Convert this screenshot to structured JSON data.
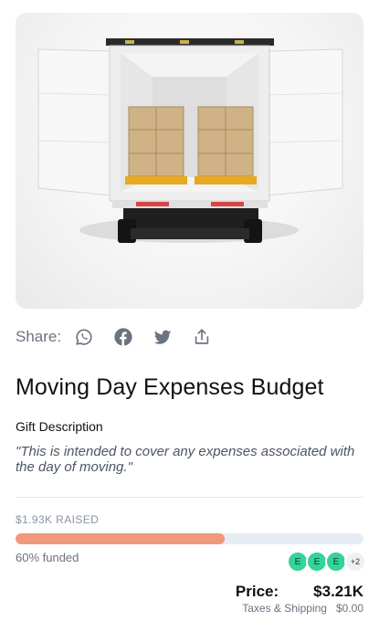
{
  "hero": {
    "image_alt": "Open moving truck with boxes on pallets"
  },
  "share": {
    "label": "Share:",
    "icons": [
      "whatsapp-icon",
      "facebook-icon",
      "twitter-icon",
      "share-upload-icon"
    ]
  },
  "registry": {
    "title": "Moving Day Expenses Budget",
    "gift_label": "Gift Description",
    "gift_description": "\"This is intended to cover any expenses associated with the day of moving.\""
  },
  "funding": {
    "raised_label": "$1.93K RAISED",
    "funded_fraction": 0.6,
    "funded_label": "60% funded",
    "contributors": [
      "E",
      "E",
      "E"
    ],
    "more_label": "+2"
  },
  "pricing": {
    "price_label": "Price:",
    "price_value": "$3.21K",
    "tax_label": "Taxes & Shipping",
    "tax_value": "$0.00"
  },
  "colors": {
    "progress_fill": "#f0987c",
    "progress_track": "#e6ecf4",
    "avatar": "#34d399"
  }
}
